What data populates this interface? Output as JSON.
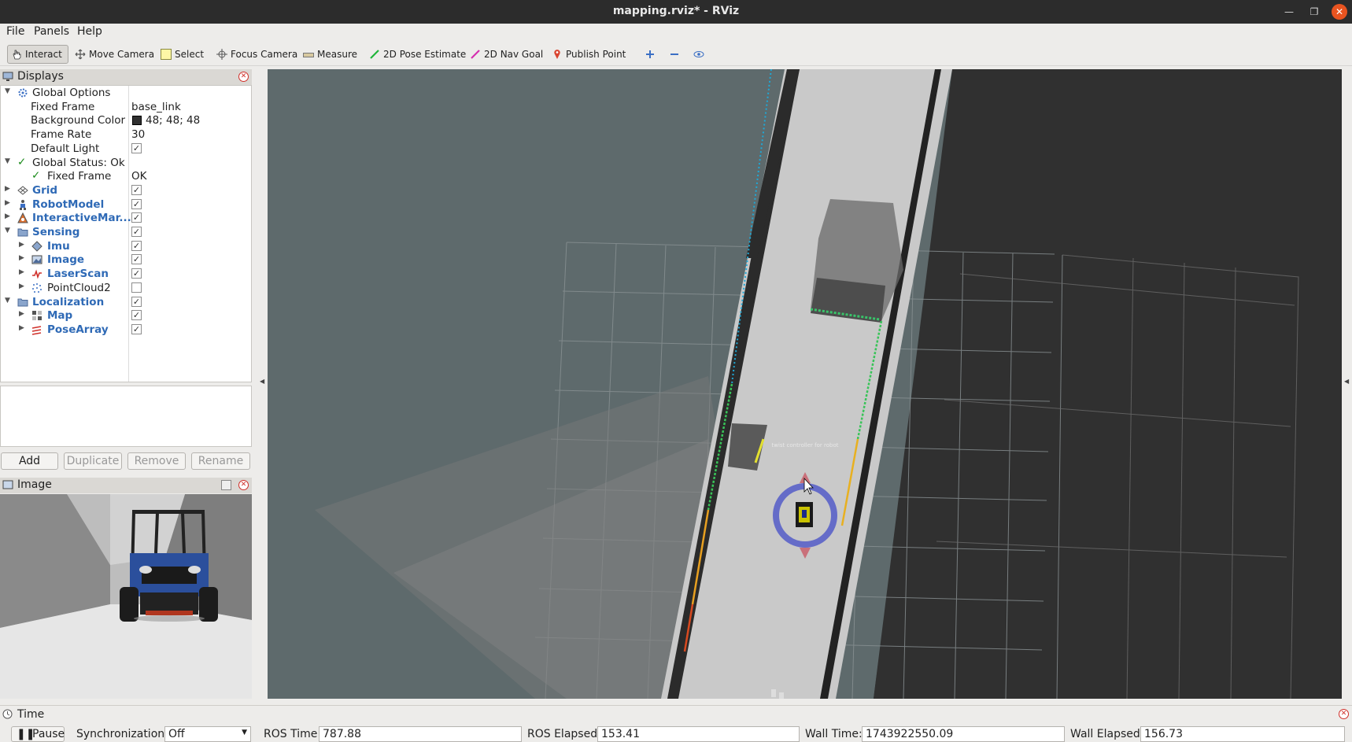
{
  "window": {
    "title": "mapping.rviz* - RViz"
  },
  "menu": {
    "file": "File",
    "panels": "Panels",
    "help": "Help"
  },
  "toolbar": {
    "interact": "Interact",
    "move_camera": "Move Camera",
    "select": "Select",
    "focus_camera": "Focus Camera",
    "measure": "Measure",
    "pose_estimate": "2D Pose Estimate",
    "nav_goal": "2D Nav Goal",
    "publish_point": "Publish Point"
  },
  "displays": {
    "title": "Displays",
    "global_options": "Global Options",
    "fixed_frame_label": "Fixed Frame",
    "fixed_frame_value": "base_link",
    "bg_color_label": "Background Color",
    "bg_color_value": "48; 48; 48",
    "frame_rate_label": "Frame Rate",
    "frame_rate_value": "30",
    "default_light_label": "Default Light",
    "global_status": "Global Status: Ok",
    "status_fixed_frame": "Fixed Frame",
    "status_fixed_frame_value": "OK",
    "items": {
      "grid": "Grid",
      "robot_model": "RobotModel",
      "interactive_markers": "InteractiveMar...",
      "sensing": "Sensing",
      "imu": "Imu",
      "image": "Image",
      "laser_scan": "LaserScan",
      "point_cloud": "PointCloud2",
      "localization": "Localization",
      "map": "Map",
      "pose_array": "PoseArray"
    },
    "checked": {
      "default_light": true,
      "grid": true,
      "robot_model": true,
      "interactive_markers": true,
      "sensing": true,
      "imu": true,
      "image": true,
      "laser_scan": true,
      "point_cloud": false,
      "localization": true,
      "map": true,
      "pose_array": true
    },
    "buttons": {
      "add": "Add",
      "duplicate": "Duplicate",
      "remove": "Remove",
      "rename": "Rename"
    }
  },
  "image_panel": {
    "title": "Image"
  },
  "viewport": {
    "marker_text": "twist controller for robot"
  },
  "time": {
    "title": "Time",
    "pause": "Pause",
    "sync_label": "Synchronization:",
    "sync_value": "Off",
    "ros_time_label": "ROS Time:",
    "ros_time": "787.88",
    "ros_elapsed_label": "ROS Elapsed:",
    "ros_elapsed": "153.41",
    "wall_time_label": "Wall Time:",
    "wall_time": "1743922550.09",
    "wall_elapsed_label": "Wall Elapsed:",
    "wall_elapsed": "156.73"
  },
  "colors": {
    "accent_close": "#e95420",
    "blue_label": "#2f6ab6",
    "bg_swatch": "#303030"
  }
}
